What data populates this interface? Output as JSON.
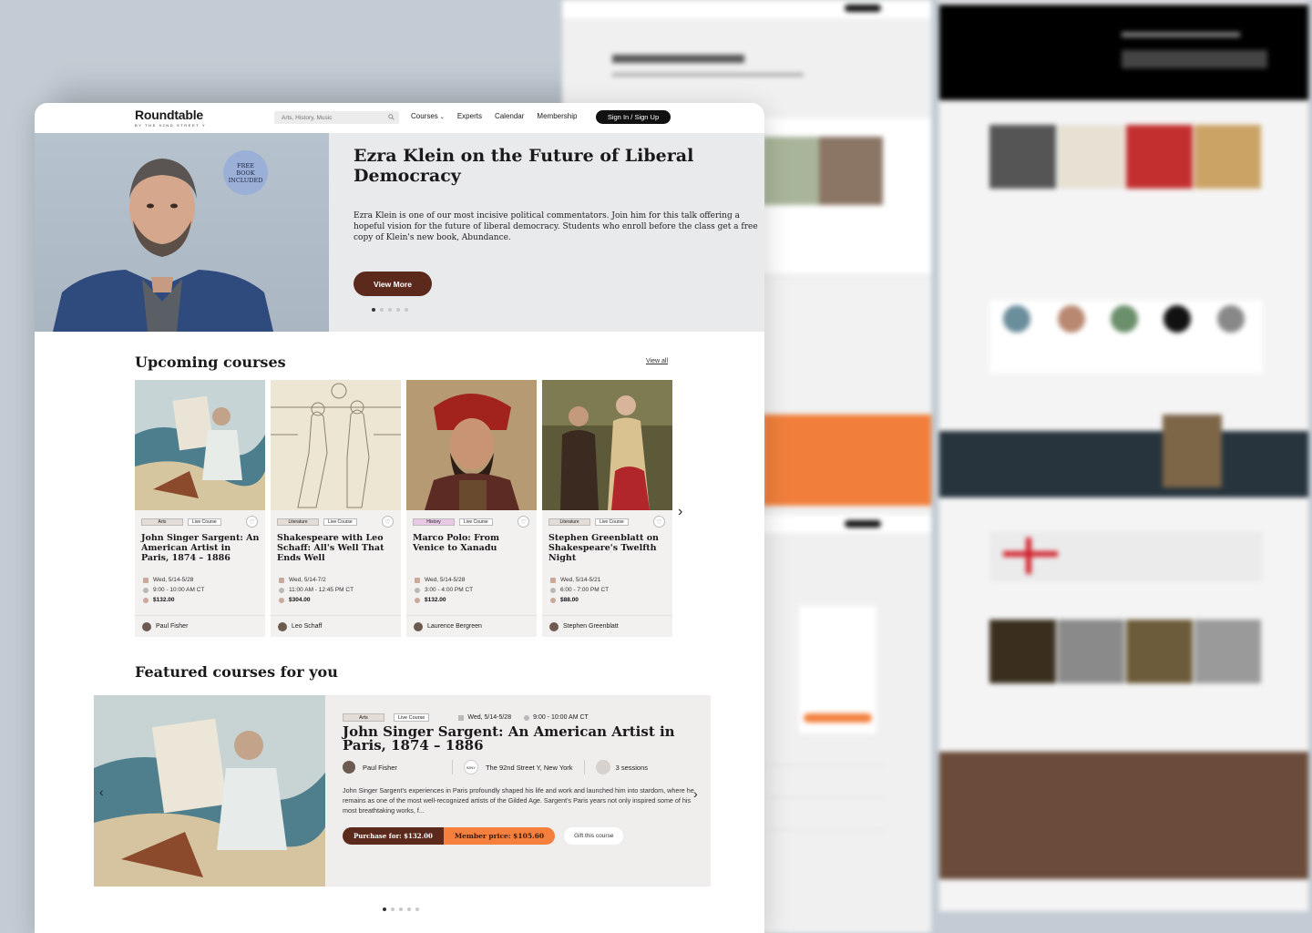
{
  "brand": {
    "name": "Roundtable",
    "tagline": "BY THE 92ND STREET Y"
  },
  "search": {
    "placeholder": "Arts, History, Music"
  },
  "nav": {
    "items": [
      "Courses",
      "Experts",
      "Calendar",
      "Membership"
    ],
    "signin_label": "Sign In / Sign Up"
  },
  "hero": {
    "badge": "FREE\nBOOK\nINCLUDED",
    "title": "Ezra Klein on the Future of Liberal Democracy",
    "description": "Ezra Klein is one of our most incisive political commentators. Join him for this talk offering a hopeful vision for the future of liberal democracy. Students who enroll before the class get a free copy of Klein's new book, Abundance.",
    "cta": "View More",
    "slide_count": 5,
    "active_slide": 0
  },
  "upcoming": {
    "title": "Upcoming courses",
    "view_all": "View all",
    "courses": [
      {
        "category": "Arts",
        "format": "Live Course",
        "title": "John Singer Sargent: An American Artist in Paris, 1874 – 1886",
        "dates": "Wed, 5/14-5/28",
        "time": "9:00 - 10:00 AM CT",
        "price": "$132.00",
        "instructor": "Paul Fisher"
      },
      {
        "category": "Literature",
        "format": "Live Course",
        "title": "Shakespeare with Leo Schaff: All's Well That Ends Well",
        "dates": "Wed, 5/14-7/2",
        "time": "11:00 AM - 12:45 PM CT",
        "price": "$304.00",
        "instructor": "Leo Schaff"
      },
      {
        "category": "History",
        "format": "Live Course",
        "title": "Marco Polo: From Venice to Xanadu",
        "dates": "Wed, 5/14-5/28",
        "time": "3:00 - 4:00 PM CT",
        "price": "$132.00",
        "instructor": "Laurence Bergreen"
      },
      {
        "category": "Literature",
        "format": "Live Course",
        "title": "Stephen Greenblatt on Shakespeare's Twelfth Night",
        "dates": "Wed, 5/14-5/21",
        "time": "6:00 - 7:00 PM CT",
        "price": "$88.00",
        "instructor": "Stephen Greenblatt"
      }
    ]
  },
  "featured": {
    "title": "Featured courses for you",
    "category": "Arts",
    "format": "Live Course",
    "dates": "Wed, 5/14-5/28",
    "time": "9:00 - 10:00 AM CT",
    "course_title": "John Singer Sargent: An American Artist in Paris, 1874 – 1886",
    "instructor": "Paul Fisher",
    "venue_logo": "92NY",
    "venue": "The 92nd Street Y, New York",
    "sessions": "3 sessions",
    "description": "John Singer Sargent's experiences in Paris profoundly shaped his life and work and launched him into stardom, where he remains as one of the most well-recognized artists of the Gilded Age. Sargent's Paris years not only inspired some of his most breathtaking works, f...",
    "purchase_label": "Purchase for: $132.00",
    "member_label": "Member price: $105.60",
    "gift_label": "Gift this course",
    "slide_count": 5,
    "active_slide": 0
  },
  "colors": {
    "brown": "#5c2a1c",
    "orange": "#f5803e",
    "hero_bg": "#e9eaec",
    "card_bg": "#f3f1f0"
  }
}
